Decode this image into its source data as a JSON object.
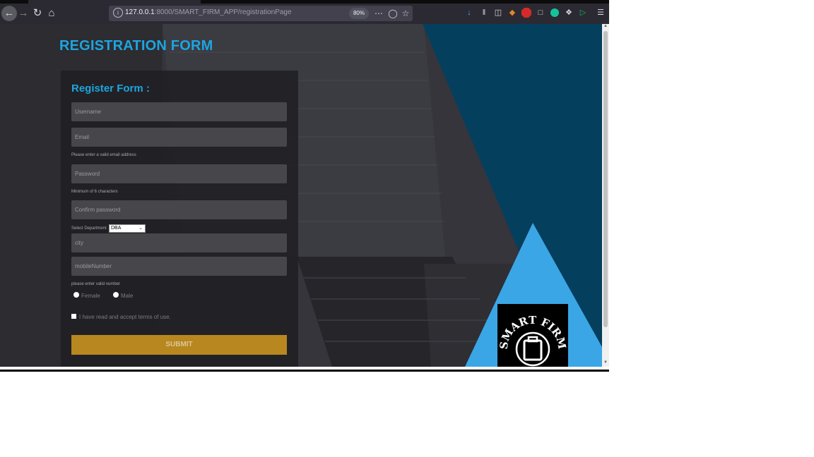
{
  "browser": {
    "url_host": "127.0.0.1",
    "url_rest": ":8000/SMART_FIRM_APP/registrationPage",
    "zoom": "80%"
  },
  "page": {
    "title": "REGISTRATION FORM",
    "form": {
      "heading": "Register Form :",
      "username_placeholder": "Username",
      "email_placeholder": "Email",
      "email_hint": "Please enter a valid email address",
      "password_placeholder": "Password",
      "password_hint": "Minimum of 6 characters",
      "confirm_placeholder": "Confirm password",
      "department_label": "Select Department",
      "department_value": "DBA",
      "city_placeholder": "city",
      "mobile_placeholder": "mobileNumber",
      "mobile_hint": "please enter valid number",
      "gender_female": "Female",
      "gender_male": "Male",
      "terms_label": "I have read and accept terms of use.",
      "submit_label": "SUBMIT"
    },
    "logo_text": "SMART FIRM"
  },
  "colors": {
    "accent_blue": "#1da5e0",
    "dark_teal": "#053f5e",
    "light_blue": "#3aa6e6",
    "submit_gold": "#b8871f"
  }
}
